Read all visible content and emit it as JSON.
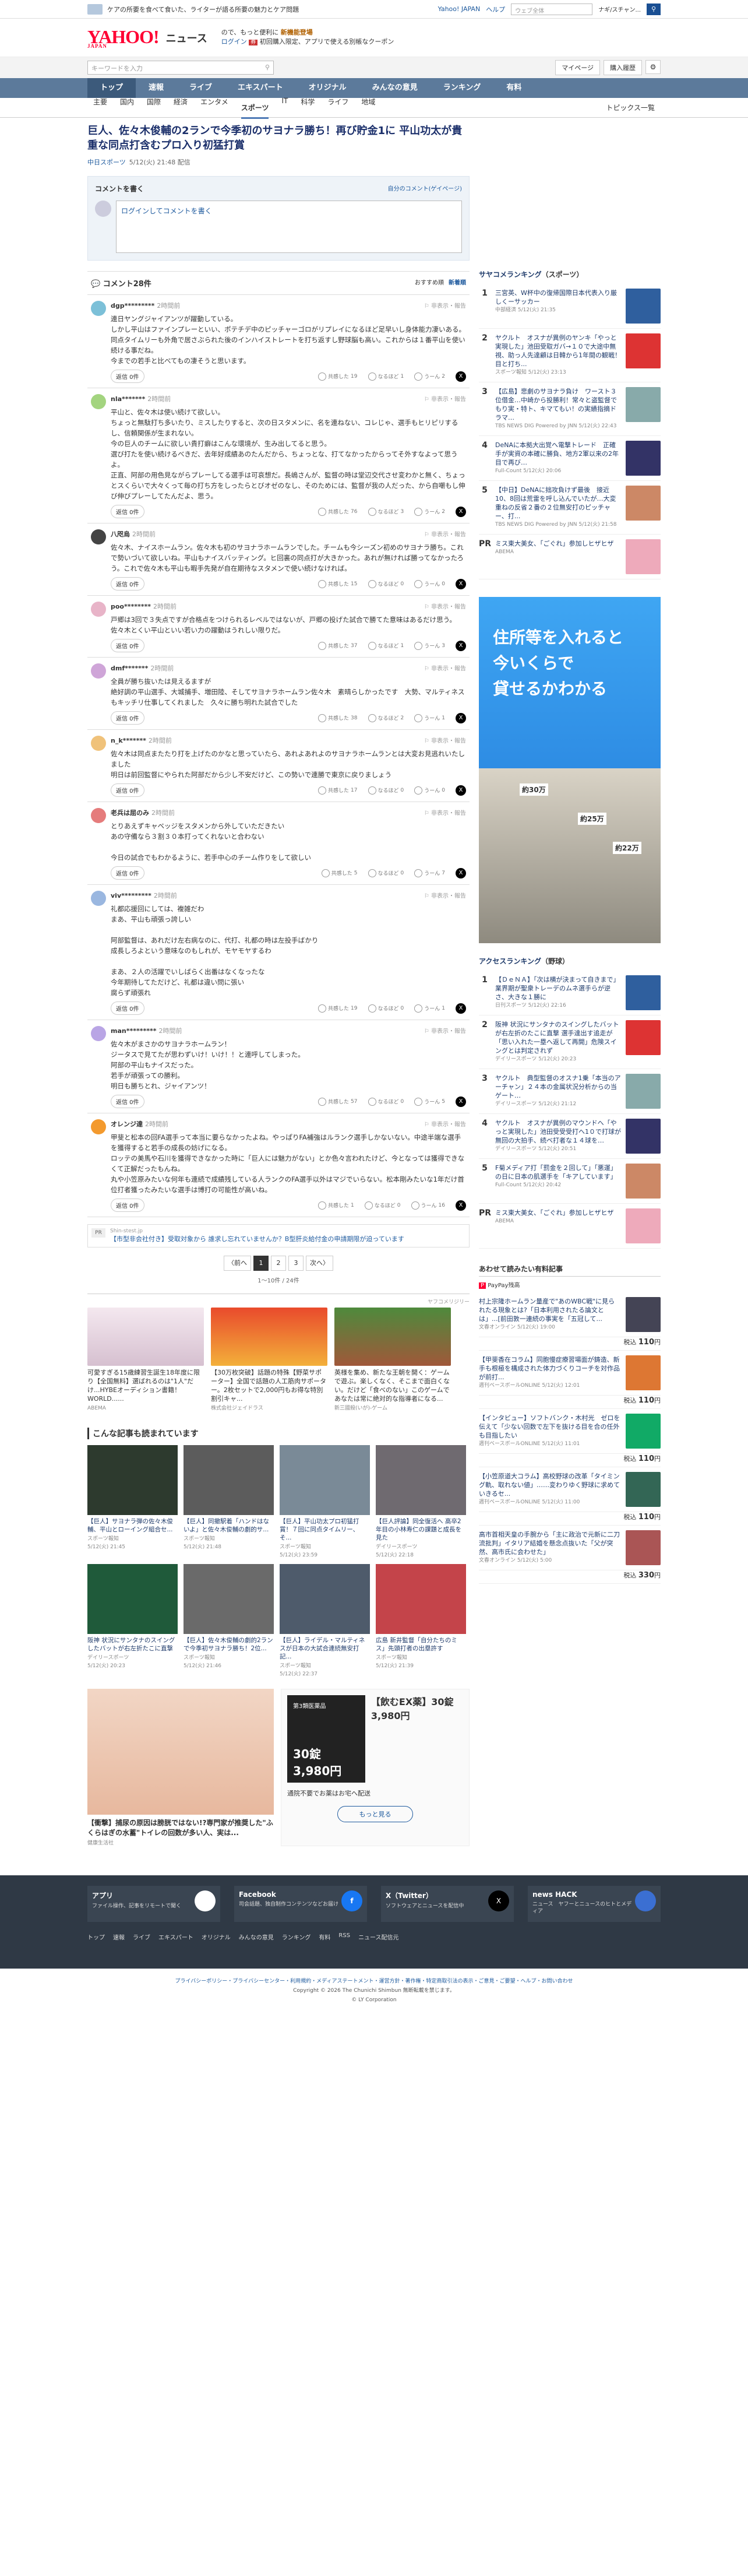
{
  "topbar": {
    "promo": "ケアの所要を食べて食いた、ライターが語る所要の魅力とケア問題",
    "links": [
      "Yahoo! JAPAN",
      "ヘルプ"
    ],
    "search_placeholder": "ウェブ全体",
    "user": "ナギ/スチャン..."
  },
  "logo": {
    "main": "YAHOO!",
    "sub": "JAPAN",
    "section": "ニュース"
  },
  "promo": {
    "line1": "ので、もっと便利に",
    "highlight": "新機能登場",
    "line2_a": "ログイン",
    "line2_b": "初回購入限定、アプリで使える別帳なクーポン"
  },
  "searchrow": {
    "placeholder": "キーワードを入力",
    "buttons": [
      "マイページ",
      "購入履歴"
    ]
  },
  "gnav": [
    "トップ",
    "速報",
    "ライブ",
    "エキスパート",
    "オリジナル",
    "みんなの意見",
    "ランキング",
    "有料"
  ],
  "snav": {
    "items": [
      "主要",
      "国内",
      "国際",
      "経済",
      "エンタメ",
      "スポーツ",
      "IT",
      "科学",
      "ライフ",
      "地域"
    ],
    "right": "トピックス一覧"
  },
  "article": {
    "title": "巨人、佐々木俊輔の2ランで今季初のサヨナラ勝ち！再び貯金1に 平山功太が貴重な同点打含むプロ入り初猛打賞",
    "source": "中日スポーツ",
    "date": "5/12(火) 21:48 配信"
  },
  "comment_box": {
    "title": "コメントを書く",
    "link": "自分のコメント(ゲイページ)",
    "placeholder": "ログインしてコメントを書く"
  },
  "comments_head": {
    "count": "コメント28件",
    "sort_a": "おすすめ順",
    "sort_b": "新着順"
  },
  "comments": [
    {
      "user": "dgp*********",
      "time": "2時間前",
      "text": "連日ヤングジャイアンツが躍動している。\nしかし平山はファインプレーといい、ポテチデ中のピッチャーゴロがリプレイになるほど足早いし身体能力凄いある。同点タイムリーも外角で居さぶられた後のインハイストレートを打ち返すし野球脳も高い。これからは１番平山を使い続ける事だね。\n今までの若手と比べてもの凄そうと思います。",
      "reply": "返信 0件",
      "a": "19",
      "b": "1",
      "c": "2"
    },
    {
      "user": "nla*******",
      "time": "2時間前",
      "text": "平山と、佐々木は使い続けて欲しい。\nちょっと無駄打ち多いたり、ミスしたりすると、次の日スタメンに、名を連ねない、コレじゃ、選手もヒリピリするし、信頼関係が生まれない。\n今の巨人のチームに欲しい貴打癖はこんな環境が、生み出してると思う。\n選び打たを使い続けるべきだ、去年好成績あのたんだから、ちょっとな、打てなかったからってそ外すなよって思うよ。\n正直、阿部の用色見ながらプレーしてる選手は可哀想だ。長嶋さんが、監督の時は堂辺交代させ変わかと無く、ちょっとスくらいで大々くって毎の打ち方をしったらとびオゼのなし、そのためには、監督が我の人だった、から自嘲もし伸び伸びプレーしてたんだよ、思う。",
      "reply": "返信 0件",
      "a": "76",
      "b": "3",
      "c": "2"
    },
    {
      "user": "八咫烏",
      "time": "2時間前",
      "text": "佐々木、ナイスホームラン。佐々木も初のサヨナラホームランでした。チームも今シーズン初めのサヨナラ勝ち。これで勢いづいて欲しいね。平山もナイスバッティング。ヒ回裏の同点打が大きかった。あれが無ければ勝ってなかったろう。これで佐々木も平山も暇手先発が自在期待なスタメンで使い続けなければ。",
      "reply": "返信 0件",
      "a": "15",
      "b": "0",
      "c": "0"
    },
    {
      "user": "poo********",
      "time": "2時間前",
      "text": "戸郷は3回で３失点ですが合格点をつけられるレベルではないが、戸郷の投げた試合で勝てた意味はあるだけ思う。佐々木とくい平山といい若い力の躍動はうれしい限りだ。",
      "reply": "返信 0件",
      "a": "37",
      "b": "1",
      "c": "3"
    },
    {
      "user": "dmf*******",
      "time": "2時間前",
      "text": "全員が勝ち抜いたは見えるますが\n絶好調の平山選手、大城捕手、増田陸、そしてサヨナラホームラン佐々木　素晴らしかったです　大勢、マルティネスもキッチリ仕事してくれました　久々に勝ち明れた試合でした",
      "reply": "返信 0件",
      "a": "38",
      "b": "2",
      "c": "1"
    },
    {
      "user": "n_k*******",
      "time": "2時間前",
      "text": "佐々木は同点またたり打を上げたのかなと思っていたら、あれよあれよのサヨナラホームランとは大変お見逃れいたしました\n明日は前回監督にやられた阿部だから少し不安だけど、この勢いで連勝で東京に戻りましょう",
      "reply": "返信 0件",
      "a": "17",
      "b": "0",
      "c": "0"
    },
    {
      "user": "老兵は屈のみ",
      "time": "2時間前",
      "text": "とりあえずキャベッジをスタメンから外していただきたい\nあの守備なら３割３０本打ってくれないと合わない\n\n今日の試合でもわかるように、若手中心のチーム作りをして欲しい",
      "reply": "返信 0件",
      "a": "5",
      "b": "0",
      "c": "7"
    },
    {
      "user": "viv*********",
      "time": "2時間前",
      "text": "礼都応援回にしては、複雑だわ\nまあ、平山も頑張っ誇しい\n\n阿部監督は、あれだけ左右病なのに、代打、礼都の時は左投手ばかり\n成長しろよという意味なのもしれが、モヤモヤするわ\n\nまあ、２人の活躍でいしばらく出番はなくなったな\n今年期待してただけど、礼都は違い問に張い\n腐らず頑張れ",
      "reply": "返信 0件",
      "a": "19",
      "b": "0",
      "c": "1"
    },
    {
      "user": "man*********",
      "time": "2時間前",
      "text": "佐々木がまさかのサヨナラホームラン！\nジータスで見てたが思わずいけ！いけ！！と連呼してしまった。\n阿部の平山もナイスだった。\n若手が頑張っての勝利。\n明日も勝ちとれ、ジャイアンツ！",
      "reply": "返信 0件",
      "a": "57",
      "b": "0",
      "c": "5"
    },
    {
      "user": "オレンジ達",
      "time": "2時間前",
      "text": "甲斐と松本の回FA選手って本当に要らなかったよね。やっぱりFA補強はルランク選手しかないない。中途半端な選手を獲得すると若手の成長の妨げになる。\nロッテの美馬や石川を獲得できなかった時に「巨人には魅力がない」とか色々言われたけど、今となっては獲得できなくて正解だったもんね。\n丸や小笠原みたいな何年も連続で成績残している人ランクのFA選手以外はマジでいらない。松本剛みたいな1年だけ首位打者獲ったみたいな選手は博打の可能性が高いね。",
      "reply": "返信 0件",
      "a": "1",
      "b": "0",
      "c": "16"
    }
  ],
  "pr": {
    "label": "Shin-stest.jp",
    "text": "【市型非会社付き】受取対象から 誰求し忘れていませんか？B型肝炎給付金の申請期限が迫っています"
  },
  "pager": {
    "prev": "〈前へ",
    "pages": [
      "1",
      "2",
      "3"
    ],
    "next": "次へ〉",
    "count": "1〜10件 / 24件"
  },
  "ads_row": {
    "tag": "ヤフコメリジリー",
    "items": [
      {
        "text": "可愛すぎる15歳練習生誕生18年度に限り【全国無料】選ばれるのは\"1人\"だけ...HYBEオーディション書籍！WORLD......",
        "src": "ABEMA"
      },
      {
        "text": "【30万枚突破】話題の特殊【野菜サポーター】全国で話題の人工筋肉サポーター。2枚セットで2,000円もお得な特別割引キャ...",
        "src": "株式会社ジェイドラス"
      },
      {
        "text": "英様を集め、新たな王朝を開く：ゲームで遊ぶ。楽しくなく、そこまで面白くない。だけど「食べのない」このゲームであなたは常に絶対的な指導者になる...",
        "src": "新三國殺(いが)-ゲーム"
      }
    ]
  },
  "also_read": {
    "title": "こんな記事も読まれています",
    "items": [
      {
        "t": "【巨人】サヨナラ弾の佐々木俊輔、平山とローイング組合セ...",
        "s": "スポーツ報知",
        "d": "5/12(火) 21:45"
      },
      {
        "t": "【巨人】同撤駅着「ハンドはないよ」と佐々木俊輔の劇的サ...",
        "s": "スポーツ報知",
        "d": "5/12(火) 21:48"
      },
      {
        "t": "【巨人】平山功太プロ初猛打賞！７回に同点タイムリー、そ...",
        "s": "スポーツ報知",
        "d": "5/12(火) 23:59"
      },
      {
        "t": "【巨人評論】同全復活へ 高卒2年目の小林寿仁の課題と成長を見た",
        "s": "デイリースポーツ",
        "d": "5/12(火) 22:18"
      },
      {
        "t": "阪神 状況にサンタナのスイングしたバットが右左折たこに直撃",
        "s": "デイリースポーツ",
        "d": "5/12(火) 20:23"
      },
      {
        "t": "【巨人】佐々木俊輔の劇的2ランで今季初サヨナラ勝ち！2位...",
        "s": "スポーツ報知",
        "d": "5/12(火) 21:46"
      },
      {
        "t": "【巨人】ライデル・マルティネスが日本の大試合連続無安打記...",
        "s": "スポーツ報知",
        "d": "5/12(火) 22:37"
      },
      {
        "t": "広島 新井監督「自分たちのミス」先頭打者の出塁許す",
        "s": "スポーツ報知",
        "d": "5/12(火) 21:39"
      }
    ]
  },
  "bigad": {
    "text": "【衝撃】捕尿の原因は膀胱ではない!?専門家が推奨した\"ふくらはぎの水蓄\"トイレの回数が多い人、実は...",
    "src": "健康生活社",
    "a2_title": "【飲むEX薬】30錠3,980円",
    "a2_price": "30錠 3,980円",
    "a2_sub": "通院不要でお薬はお宅へ配送",
    "a2_tag": "第3類医薬品",
    "more": "もっと見る"
  },
  "rank1": {
    "title_a": "サヤコメランキング",
    "title_b": "（スポーツ）",
    "items": [
      {
        "n": "1",
        "c": "",
        "t": "三宮英、W杯中の復帰国際日本代表入り厳しくーサッカー",
        "s": "中部経済 5/12(火) 21:35"
      },
      {
        "n": "2",
        "c": "",
        "t": "ヤクルト　オスナが異例のヤンキ「やっと実現した」池田受取ガバ→１０で大途中無視、助っ人先達顧は日韓から1年間の観戦！ 目と打ち...",
        "s": "スポーツ報知 5/12(火) 23:13"
      },
      {
        "n": "3",
        "c": "",
        "t": "【広島】悲劇のサヨナラ負け　ワースト３位借金…中崎から投勝利！常々と盗監督でもり実・特ト、キマてもい！の実績指摘ドラマ…",
        "s": "TBS NEWS DIG Powered by JNN 5/12(火) 22:43"
      },
      {
        "n": "4",
        "c": "",
        "t": "DeNAに本拠大出覚へ電撃トレード　正確手が実資の本確に勝負、地方2軍以来の2年目で再び…",
        "s": "Full-Count 5/12(火) 20:06"
      },
      {
        "n": "5",
        "c": "",
        "t": "【中日】DeNAに拙攻負けず最後　接近10、8回は荒雷を呼し込んでいたが…大変重ねの反省２番の２位無安打のピッチャー、打...",
        "s": "TBS NEWS DIG Powered by JNN 5/12(火) 21:58"
      },
      {
        "n": "PR",
        "c": "",
        "t": "ミス東大美女、「ごぐれ」参加しヒザヒザ",
        "s": "ABEMA"
      }
    ]
  },
  "sidead": {
    "title": "住所等を入れると\n今いくらで\n貸せるかわかる",
    "pins": [
      "約30万",
      "約25万",
      "約22万"
    ]
  },
  "rank2": {
    "title_a": "アクセスランキング",
    "title_b": "（野球）",
    "items": [
      {
        "n": "1",
        "t": "【ＤｅＮＡ】「次は横が決まって自きまで」業界期が聖衆トレーデのムネ選手らが逆さ、大きな１勝に",
        "s": "日刊スポーツ 5/12(火) 22:16"
      },
      {
        "n": "2",
        "t": "阪神 状況にサンタナのスイングしたバットが右左折のたこに直撃 選手達出す追走が「思い入れた一塁へ返して再開」危険スイングとは判定されず",
        "s": "デイリースポーツ 5/12(火) 20:23"
      },
      {
        "n": "3",
        "t": "ヤクルト　典型監督のオスナ1乗「本当のアーチャン」２４本の金属状況分析からの当ゲート…",
        "s": "デイリースポーツ 5/12(火) 21:12"
      },
      {
        "n": "4",
        "t": "ヤクルト　オスナが異例のマウンドへ「やっと実現した」池田受受受打へ1０で打球が無回の大拍手、続ベ打者な１４球を…",
        "s": "デイリースポーツ 5/12(火) 20:51"
      },
      {
        "n": "5",
        "t": "F菊メディア打「罰金を２回して」「悪運」の日に日本の肌選手を「キアしています」",
        "s": "Full-Count 5/12(火) 20:42"
      },
      {
        "n": "PR",
        "t": "ミス東大美女、「ごぐれ」参加しヒザヒザ",
        "s": "ABEMA"
      }
    ]
  },
  "rec": {
    "title": "あわせて読みたい有料記事",
    "paypay": "PayPay残高",
    "items": [
      {
        "t": "村上宗隆ホームラン量産で\"あのWBC戦\"に見られたる現象とは?「日本利用されたる論文とは」...[前田敦一連続の事実を「五冠して...",
        "s": "文春オンライン 5/12(火) 19:00",
        "p": "110"
      },
      {
        "t": "【甲斐香在コラム】同胞慢症療習場面が鋳造、新手も根極を構成された体力づくりコーチを対作品が前打...",
        "s": "週刊ベースボールONLINE 5/12(火) 12:01",
        "p": "110"
      },
      {
        "t": "【インタビュー】ソフトバンク・木村光　ゼロを伝えて「少ない回数で左下を抜ける目を合の任外も目指したい",
        "s": "週刊ベースボールONLINE 5/12(火) 11:01",
        "p": "110"
      },
      {
        "t": "【小笠原道大コラム】高校野球の改革「タイミング軌、取れない値」……変わりゆく野球に求めていきるセ...",
        "s": "週刊ベースボールONLINE 5/12(火) 11:00",
        "p": "110"
      },
      {
        "t": "高市首相天皇の手腕から「主に政治で元新に二刀流批判」イタリア結婚を懸念点抜いた「父が突然、高市氏に会わせた」",
        "s": "文春オンライン 5/12(火) 5:00",
        "p": "330"
      }
    ]
  },
  "footer": {
    "cols": [
      {
        "t": "アプリ",
        "d": "ファイル操作、記事をリモートで聞く"
      },
      {
        "t": "Facebook",
        "d": "司会話題、独自制作コンテンツなどお届け"
      },
      {
        "t": "X（Twitter）",
        "d": "ソフトウェアとニュースを配信中"
      },
      {
        "t": "news HACK",
        "d": "ニュース　ヤフーとニュースのヒトとメディア"
      }
    ],
    "links": [
      "トップ",
      "速報",
      "ライブ",
      "エキスパート",
      "オリジナル",
      "みんなの意見",
      "ランキング",
      "有料",
      "RSS",
      "ニュース配信元"
    ]
  },
  "legal": {
    "line1": "プライバシーポリシー・プライバシーセンター・利用規約・メディアステートメント・運営方針・著作権・特定商取引法の表示・ご意見・ご要望・ヘルプ・お問い合わせ",
    "line2": "Copyright © 2026 The Chunichi Shimbun 無断転載を禁じます。",
    "line3": "© LY Corporation"
  },
  "colors": {
    "title": "#1a2e6a",
    "nav": "#5c7a9b",
    "brand": "#ff0033"
  }
}
